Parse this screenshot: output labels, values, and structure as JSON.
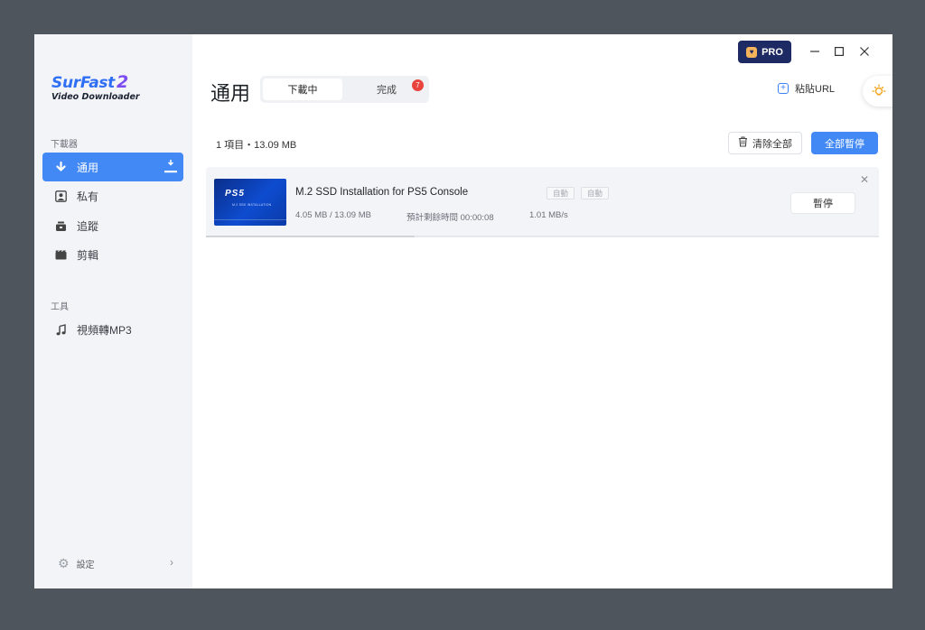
{
  "app": {
    "logo_name": "SurFast",
    "logo_version": "2",
    "logo_subtitle": "Video Downloader"
  },
  "sidebar": {
    "section_downloader": "下載器",
    "items": [
      {
        "label": "通用",
        "icon": "download-arrow-icon",
        "active": true
      },
      {
        "label": "私有",
        "icon": "private-icon",
        "active": false
      },
      {
        "label": "追蹤",
        "icon": "tracking-icon",
        "active": false
      },
      {
        "label": "剪輯",
        "icon": "clip-icon",
        "active": false
      }
    ],
    "section_tools": "工具",
    "tools": [
      {
        "label": "視頻轉MP3",
        "icon": "music-note-icon"
      }
    ],
    "settings_label": "設定"
  },
  "titlebar": {
    "pro_label": "PRO"
  },
  "header": {
    "title": "通用",
    "tabs": [
      {
        "label": "下載中",
        "active": true
      },
      {
        "label": "完成",
        "active": false
      }
    ],
    "completed_badge": "7",
    "paste_url_label": "粘貼URL"
  },
  "toolbar": {
    "summary": "1 項目・13.09 MB",
    "clear_all_label": "清除全部",
    "pause_all_label": "全部暫停"
  },
  "tasks": [
    {
      "title": "M.2 SSD Installation for PS5 Console",
      "thumb_logo": "PS5",
      "thumb_caption": "M.2 SSD INSTALLATION",
      "tag1": "自動",
      "tag2": "自動",
      "size": "4.05 MB / 13.09 MB",
      "eta": "預計剩餘時間 00:00:08",
      "speed": "1.01 MB/s",
      "progress": 0.31,
      "pause_label": "暫停"
    }
  ],
  "colors": {
    "accent": "#4289f6",
    "pro_bg": "#1e2a63",
    "badge": "#e8433d"
  }
}
